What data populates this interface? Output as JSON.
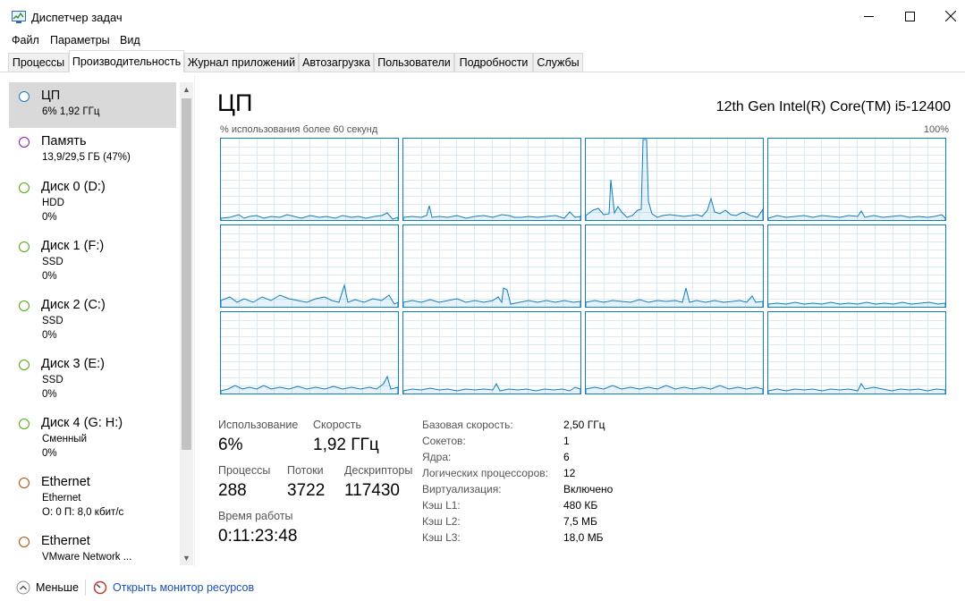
{
  "window": {
    "title": "Диспетчер задач",
    "minimize_icon": "minimize-icon",
    "maximize_icon": "maximize-icon",
    "close_icon": "close-icon"
  },
  "menu": [
    "Файл",
    "Параметры",
    "Вид"
  ],
  "tabs": [
    {
      "label": "Процессы",
      "active": false
    },
    {
      "label": "Производительность",
      "active": true
    },
    {
      "label": "Журнал приложений",
      "active": false
    },
    {
      "label": "Автозагрузка",
      "active": false
    },
    {
      "label": "Пользователи",
      "active": false
    },
    {
      "label": "Подробности",
      "active": false
    },
    {
      "label": "Службы",
      "active": false
    }
  ],
  "sidebar": {
    "items": [
      {
        "name": "ЦП",
        "sub": [
          "6% 1,92 ГГц"
        ],
        "color": "#117dbb",
        "selected": true
      },
      {
        "name": "Память",
        "sub": [
          "13,9/29,5 ГБ (47%)"
        ],
        "color": "#8b12ae",
        "selected": false
      },
      {
        "name": "Диск 0 (D:)",
        "sub": [
          "HDD",
          "0%"
        ],
        "color": "#4da60c",
        "selected": false
      },
      {
        "name": "Диск 1 (F:)",
        "sub": [
          "SSD",
          "0%"
        ],
        "color": "#4da60c",
        "selected": false
      },
      {
        "name": "Диск 2 (C:)",
        "sub": [
          "SSD",
          "0%"
        ],
        "color": "#4da60c",
        "selected": false
      },
      {
        "name": "Диск 3 (E:)",
        "sub": [
          "SSD",
          "0%"
        ],
        "color": "#4da60c",
        "selected": false
      },
      {
        "name": "Диск 4 (G: H:)",
        "sub": [
          "Сменный",
          "0%"
        ],
        "color": "#4da60c",
        "selected": false
      },
      {
        "name": "Ethernet",
        "sub": [
          "Ethernet",
          "О: 0 П: 8,0 кбит/с"
        ],
        "color": "#a74f01",
        "selected": false
      },
      {
        "name": "Ethernet",
        "sub": [
          "VMware Network ..."
        ],
        "color": "#a74f01",
        "selected": false
      }
    ]
  },
  "main": {
    "title": "ЦП",
    "model": "12th Gen Intel(R) Core(TM) i5-12400",
    "graph_caption": "% использования более 60 секунд",
    "graph_max": "100%",
    "graph_color": "#117dbb",
    "stats": {
      "usage_label": "Использование",
      "usage_value": "6%",
      "speed_label": "Скорость",
      "speed_value": "1,92 ГГц",
      "processes_label": "Процессы",
      "processes_value": "288",
      "threads_label": "Потоки",
      "threads_value": "3722",
      "handles_label": "Дескрипторы",
      "handles_value": "117430",
      "uptime_label": "Время работы",
      "uptime_value": "0:11:23:48"
    },
    "info": [
      {
        "label": "Базовая скорость:",
        "value": "2,50 ГГц"
      },
      {
        "label": "Сокетов:",
        "value": "1"
      },
      {
        "label": "Ядра:",
        "value": "6"
      },
      {
        "label": "Логических процессоров:",
        "value": "12"
      },
      {
        "label": "Виртуализация:",
        "value": "Включено"
      },
      {
        "label": "Кэш L1:",
        "value": "480 КБ"
      },
      {
        "label": "Кэш L2:",
        "value": "7,5 МБ"
      },
      {
        "label": "Кэш L3:",
        "value": "18,0 МБ"
      }
    ]
  },
  "footer": {
    "less_label": "Меньше",
    "less_icon": "chevron-up-icon",
    "monitor_link": "Открыть монитор ресурсов",
    "monitor_icon": "resource-monitor-icon"
  }
}
